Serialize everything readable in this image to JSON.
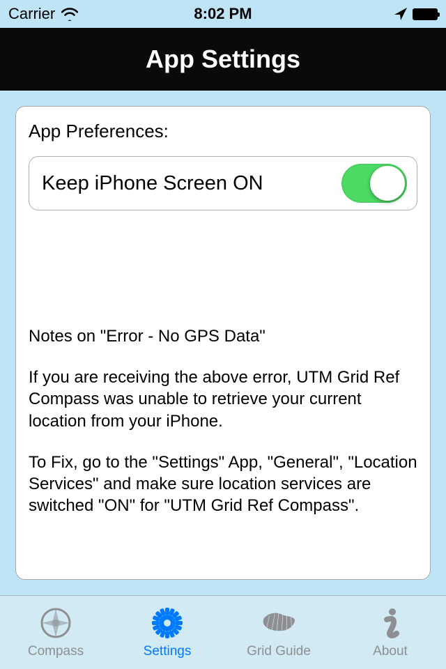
{
  "status_bar": {
    "carrier": "Carrier",
    "time": "8:02 PM"
  },
  "title": "App Settings",
  "preferences": {
    "section_label": "App Preferences:",
    "keep_screen_on": {
      "label": "Keep iPhone Screen ON",
      "value": true
    }
  },
  "notes": {
    "heading": "Notes on \"Error - No GPS Data\"",
    "para1": "If you are receiving the above error, UTM Grid Ref Compass was unable to retrieve your current location from your iPhone.",
    "para2": "To Fix, go to the \"Settings\" App, \"General\", \"Location Services\" and make sure location services are switched \"ON\" for \"UTM Grid Ref Compass\"."
  },
  "tabs": {
    "compass": "Compass",
    "settings": "Settings",
    "grid_guide": "Grid Guide",
    "about": "About"
  },
  "colors": {
    "accent": "#007aff",
    "switch_on": "#4cd964",
    "bg": "#bfe4f5"
  }
}
